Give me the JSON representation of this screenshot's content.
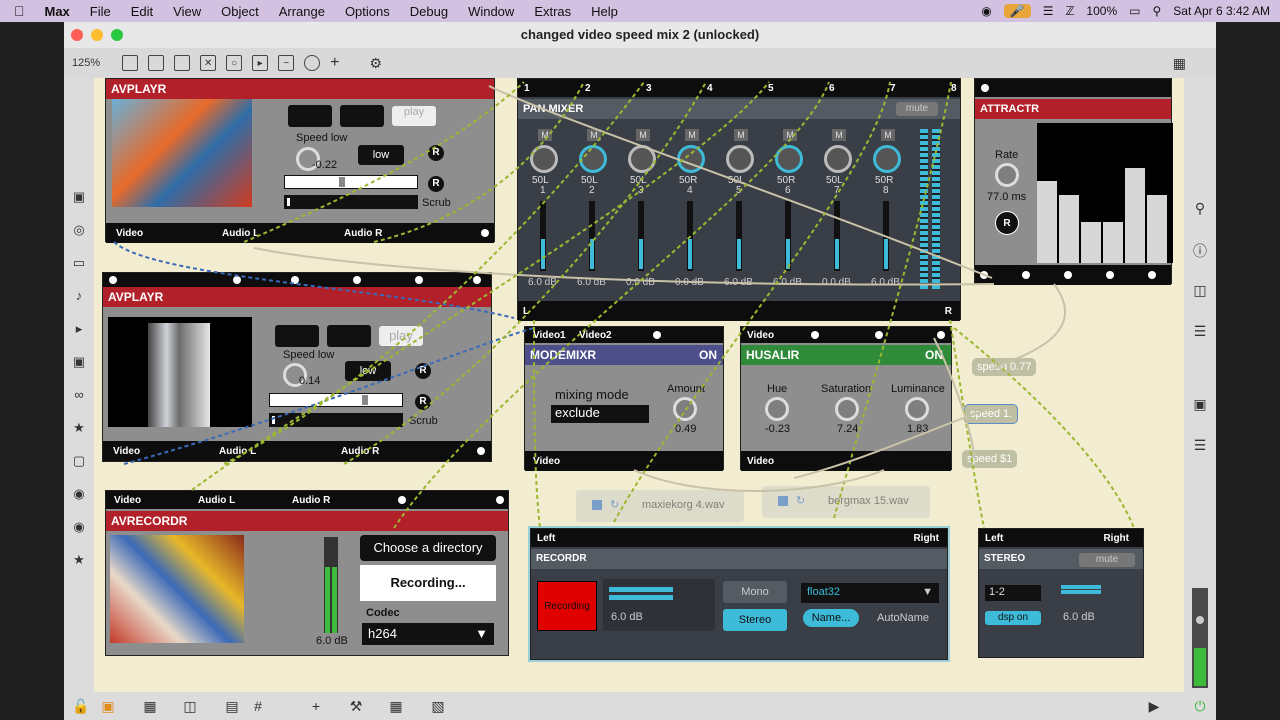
{
  "menubar": {
    "app": "Max",
    "items": [
      "File",
      "Edit",
      "View",
      "Object",
      "Arrange",
      "Options",
      "Debug",
      "Window",
      "Extras",
      "Help"
    ],
    "battery": "100%",
    "datetime": "Sat Apr 6  3:42 AM"
  },
  "window": {
    "title": "changed video speed mix 2 (unlocked)",
    "zoom": "125%"
  },
  "avplayr1": {
    "title": "AVPLAYR",
    "play": "play",
    "speed_label": "Speed low",
    "speed_value": "-0.22",
    "low": "low",
    "r": "R",
    "scrub": "Scrub",
    "outs": [
      "Video",
      "Audio L",
      "Audio R"
    ]
  },
  "avplayr2": {
    "title": "AVPLAYR",
    "play": "play",
    "speed_label": "Speed low",
    "speed_value": "0.14",
    "low": "low",
    "r": "R",
    "scrub": "Scrub",
    "outs": [
      "Video",
      "Audio L",
      "Audio R"
    ]
  },
  "panmixer": {
    "title": "PAN MIXER",
    "mute": "mute",
    "channels": [
      "1",
      "2",
      "3",
      "4",
      "5",
      "6",
      "7",
      "8"
    ],
    "m": "M",
    "pans": [
      "50L",
      "50L",
      "50L",
      "50R",
      "50L",
      "50R",
      "50L",
      "50R"
    ],
    "gains": [
      "6.0 dB",
      "6.0 dB",
      "0.0 dB",
      "0.0 dB",
      "6.0 dB",
      "6.0 dB",
      "0.0 dB",
      "6.0 dB"
    ],
    "l": "L",
    "r": "R"
  },
  "attractr": {
    "title": "ATTRACTR",
    "rate_label": "Rate",
    "rate_value": "77.0 ms",
    "r": "R",
    "bars": [
      0.6,
      0.5,
      0.3,
      0.3,
      0.7,
      0.5
    ]
  },
  "modemixr": {
    "title": "MODEMIXR",
    "on": "ON",
    "ins": [
      "Video1",
      "Video2"
    ],
    "mode_label": "mixing mode",
    "mode_value": "exclude",
    "amount_label": "Amount",
    "amount_value": "0.49",
    "out": "Video"
  },
  "husalir": {
    "title": "HUSALIR",
    "on": "ON",
    "in": "Video",
    "hue_label": "Hue",
    "hue_value": "-0.23",
    "sat_label": "Saturation",
    "sat_value": "7.24",
    "lum_label": "Luminance",
    "lum_value": "1.83",
    "out": "Video"
  },
  "comments": {
    "speed1": "speed 0.77",
    "speed2": "speed 1.",
    "speed3": "speed $1"
  },
  "sfplay": {
    "file1": "maxiekorg 4.wav",
    "file2": "bergmax 15.wav"
  },
  "avrecordr": {
    "title": "AVRECORDR",
    "ins": [
      "Video",
      "Audio L",
      "Audio R"
    ],
    "choose": "Choose a directory",
    "recording": "Recording...",
    "gain": "6.0 dB",
    "codec_label": "Codec",
    "codec_value": "h264"
  },
  "recordr": {
    "title": "RECORDR",
    "ins": [
      "Left",
      "Right"
    ],
    "recording": "Recording",
    "gain": "6.0 dB",
    "mono": "Mono",
    "stereo": "Stereo",
    "format": "float32",
    "name": "Name...",
    "autoname": "AutoName"
  },
  "stereo": {
    "title": "STEREO",
    "ins": [
      "Left",
      "Right"
    ],
    "mute": "mute",
    "channels": "1-2",
    "dsp": "dsp on",
    "gain": "6.0 dB"
  }
}
